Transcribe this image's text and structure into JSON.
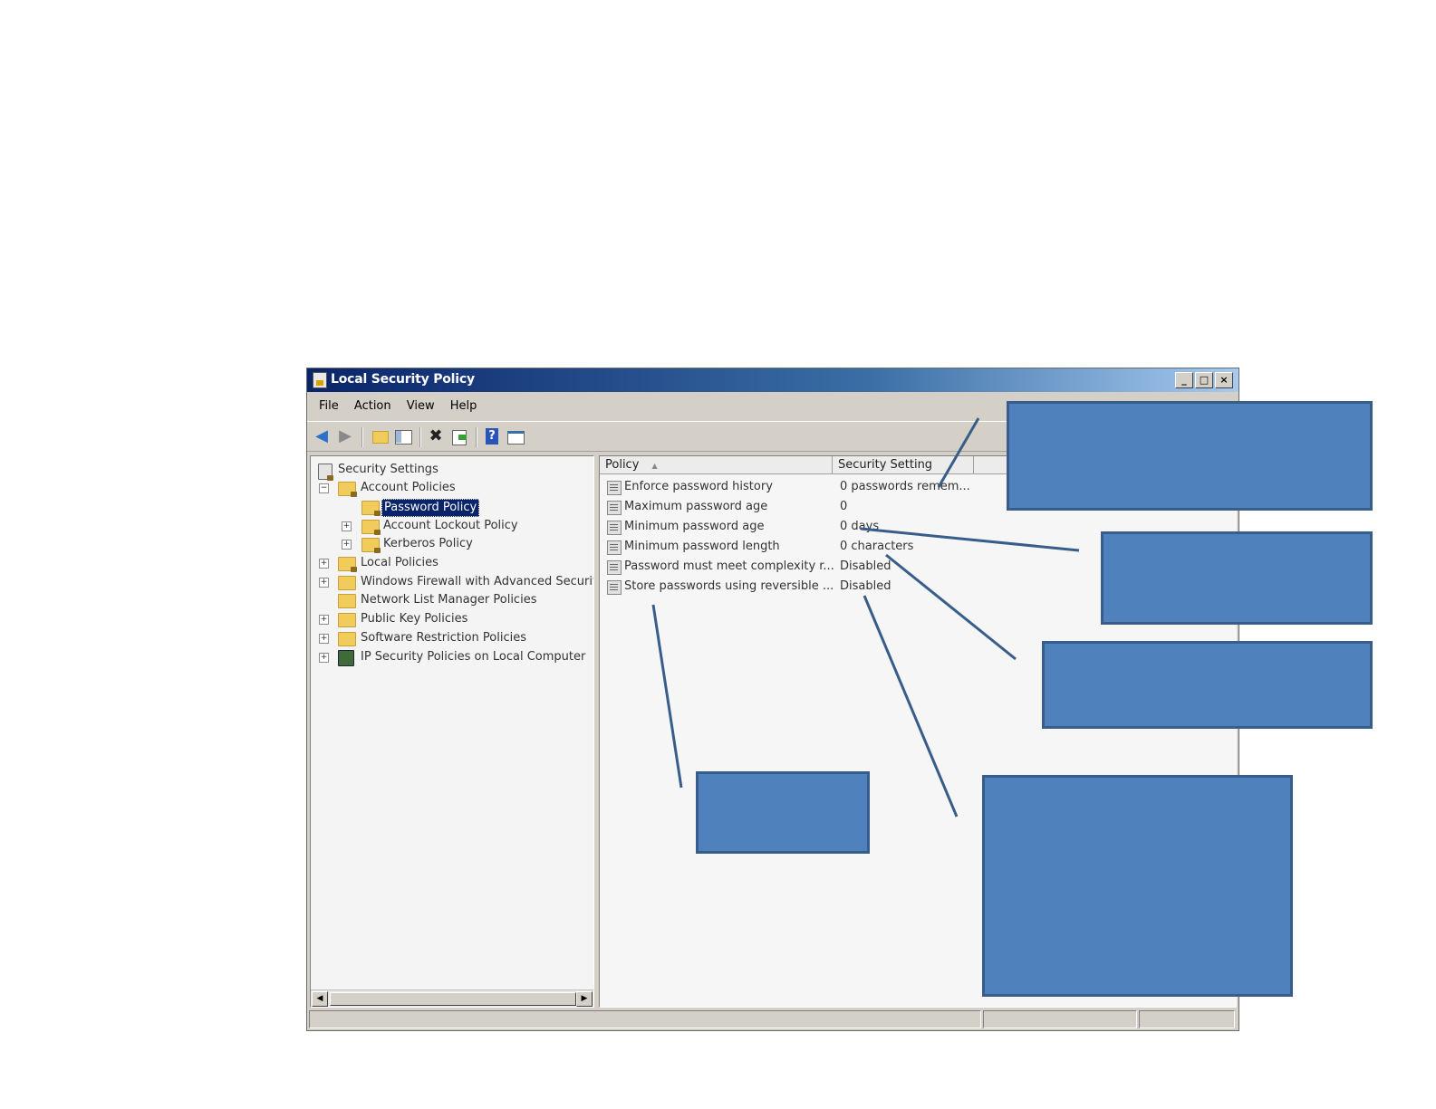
{
  "window": {
    "title": "Local Security Policy",
    "controls": {
      "minimize": "_",
      "maximize": "□",
      "close": "×"
    }
  },
  "menu": [
    "File",
    "Action",
    "View",
    "Help"
  ],
  "toolbar_icons": [
    "back-icon",
    "forward-icon",
    "up-folder-icon",
    "show-hide-tree-icon",
    "delete-icon",
    "export-list-icon",
    "help-icon",
    "properties-icon"
  ],
  "tree": {
    "root": "Security Settings",
    "items": [
      {
        "label": "Account Policies",
        "expander": "−"
      },
      {
        "label": "Password Policy"
      },
      {
        "label": "Account Lockout Policy",
        "expander": "+"
      },
      {
        "label": "Kerberos Policy",
        "expander": "+"
      },
      {
        "label": "Local Policies",
        "expander": "+"
      },
      {
        "label": "Windows Firewall with Advanced Security",
        "expander": "+"
      },
      {
        "label": "Network List Manager Policies"
      },
      {
        "label": "Public Key Policies",
        "expander": "+"
      },
      {
        "label": "Software Restriction Policies",
        "expander": "+"
      },
      {
        "label": "IP Security Policies on Local Computer",
        "expander": "+"
      }
    ],
    "selected": "Password Policy"
  },
  "list": {
    "columns": {
      "policy": "Policy",
      "policy_sort": "▲",
      "setting": "Security Setting"
    },
    "rows": [
      {
        "policy": "Enforce password history",
        "setting": "0 passwords remem..."
      },
      {
        "policy": "Maximum password age",
        "setting": "0"
      },
      {
        "policy": "Minimum password age",
        "setting": "0 days"
      },
      {
        "policy": "Minimum password length",
        "setting": "0 characters"
      },
      {
        "policy": "Password must meet complexity r...",
        "setting": "Disabled"
      },
      {
        "policy": "Store passwords using reversible ...",
        "setting": "Disabled"
      }
    ]
  },
  "colors": {
    "callout_fill": "#4f81bd",
    "callout_border": "#385d8a",
    "selection": "#0a246a"
  }
}
